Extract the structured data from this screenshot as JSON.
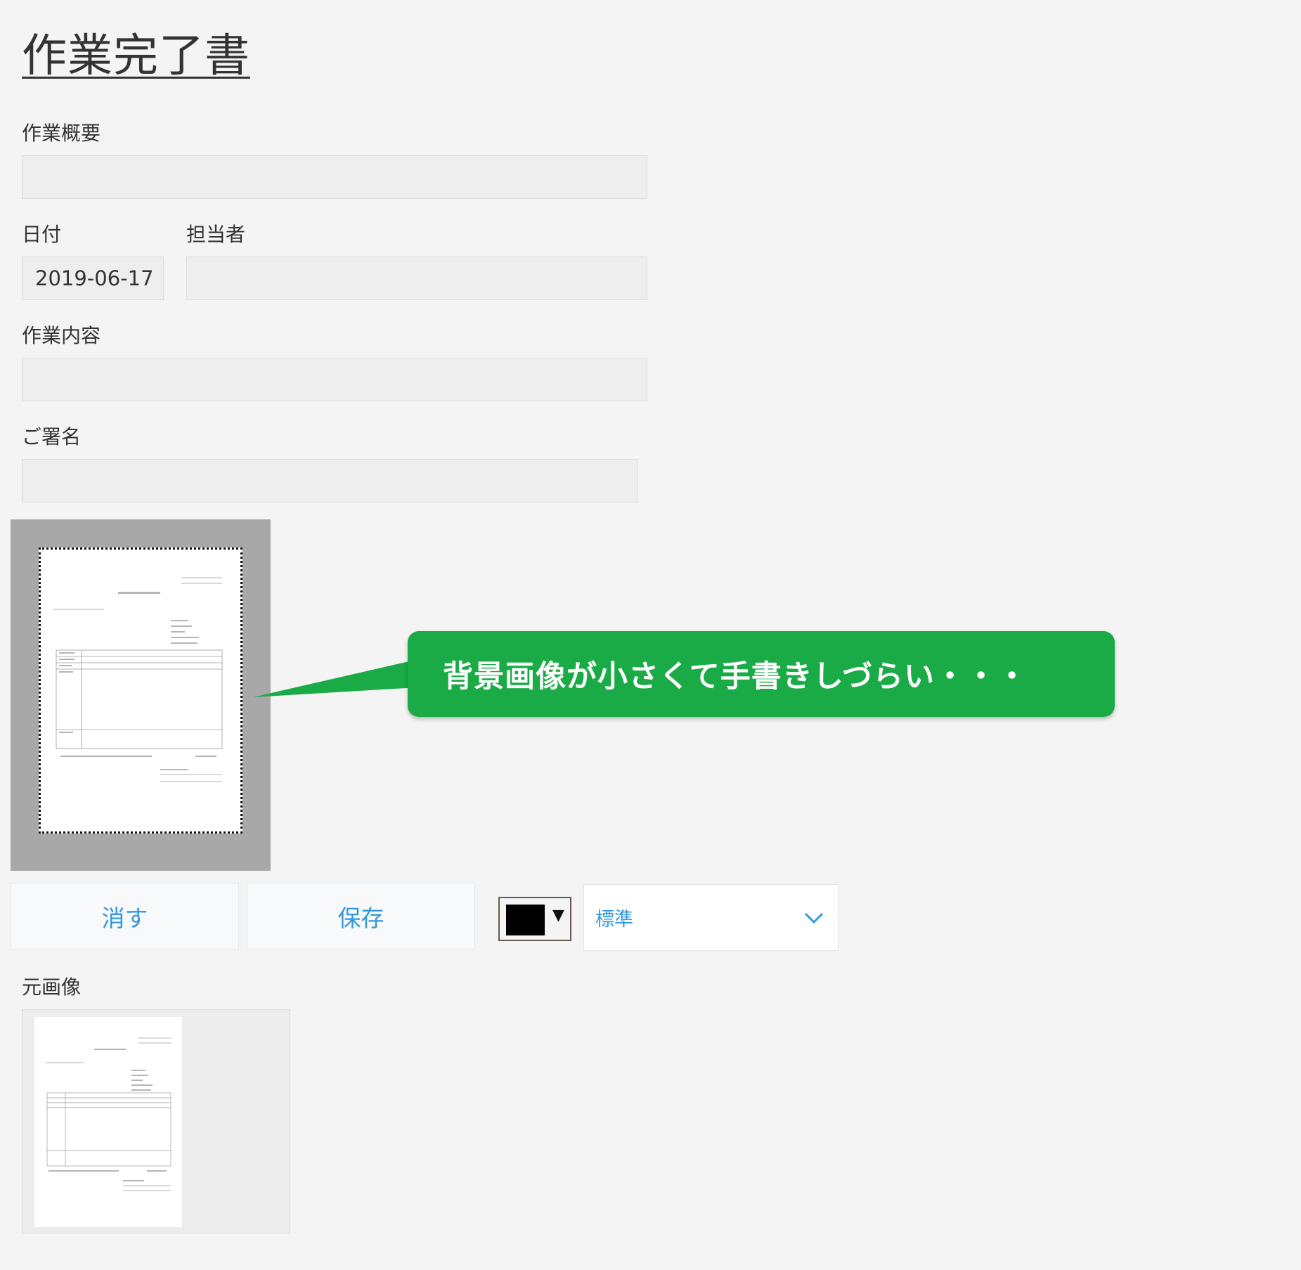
{
  "page": {
    "title": "作業完了書"
  },
  "form": {
    "summary_label": "作業概要",
    "summary_value": "",
    "date_label": "日付",
    "date_value": "2019-06-17",
    "person_label": "担当者",
    "person_value": "",
    "content_label": "作業内容",
    "content_value": "",
    "signature_label": "ご署名",
    "signature_value": ""
  },
  "toolbar": {
    "clear_label": "消す",
    "save_label": "保存",
    "pen_color": "#000000",
    "dropdown_arrow": "▼",
    "size_selected": "標準"
  },
  "callout": {
    "text": "背景画像が小さくて手書きしづらい・・・",
    "color": "#1aab47"
  },
  "original": {
    "label": "元画像"
  },
  "colors": {
    "accent": "#3498db",
    "background": "#f4f4f4",
    "field_bg": "#eeeeee"
  }
}
